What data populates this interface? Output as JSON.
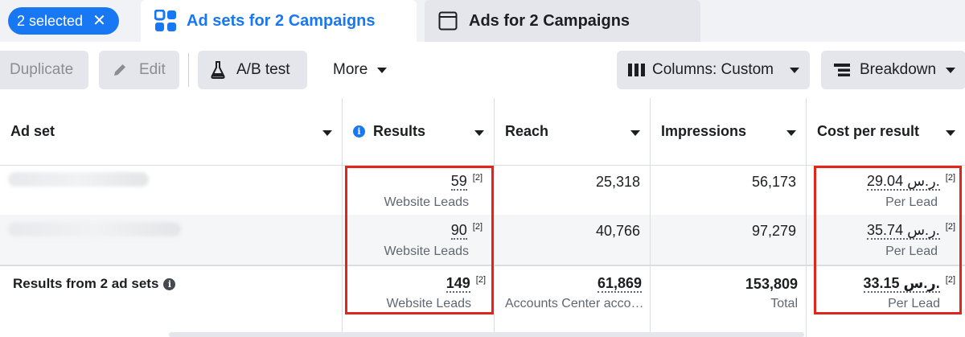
{
  "selection_chip": {
    "label": "2 selected",
    "close": "✕"
  },
  "tabs": [
    {
      "label": "Ad sets for 2 Campaigns",
      "icon": "grid-icon"
    },
    {
      "label": "Ads for 2 Campaigns",
      "icon": "window-icon"
    }
  ],
  "toolbar": {
    "duplicate": "Duplicate",
    "edit": "Edit",
    "ab_test": "A/B test",
    "more": "More",
    "columns": "Columns: Custom",
    "breakdown": "Breakdown"
  },
  "table": {
    "headers": [
      "Ad set",
      "Results",
      "Reach",
      "Impressions",
      "Cost per result"
    ],
    "rows": [
      {
        "results": "59",
        "results_ref": "[2]",
        "results_sub": "Website Leads",
        "reach": "25,318",
        "impressions": "56,173",
        "cost": "29.04 ر.س.",
        "cost_ref": "[2]",
        "cost_sub": "Per Lead"
      },
      {
        "results": "90",
        "results_ref": "[2]",
        "results_sub": "Website Leads",
        "reach": "40,766",
        "impressions": "97,279",
        "cost": "35.74 ر.س.",
        "cost_ref": "[2]",
        "cost_sub": "Per Lead"
      }
    ],
    "summary": {
      "label": "Results from 2 ad sets",
      "results": "149",
      "results_ref": "[2]",
      "results_sub": "Website Leads",
      "reach": "61,869",
      "reach_sub": "Accounts Center acco…",
      "impressions": "153,809",
      "impressions_sub": "Total",
      "cost": "33.15 ر.س.",
      "cost_ref": "[2]",
      "cost_sub": "Per Lead"
    }
  },
  "colors": {
    "accent": "#1877f2",
    "highlight": "#e0251b"
  }
}
